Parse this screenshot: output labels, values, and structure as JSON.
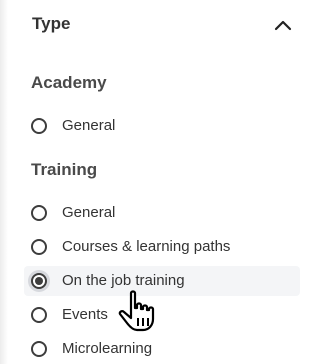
{
  "filter_group": {
    "title": "Type",
    "collapse_icon": "chevron-up-icon"
  },
  "sections": [
    {
      "title": "Academy",
      "options": [
        {
          "label": "General",
          "selected": false
        }
      ]
    },
    {
      "title": "Training",
      "options": [
        {
          "label": "General",
          "selected": false
        },
        {
          "label": "Courses & learning paths",
          "selected": false
        },
        {
          "label": "On the job training",
          "selected": true
        },
        {
          "label": "Events",
          "selected": false
        },
        {
          "label": "Microlearning",
          "selected": false
        }
      ]
    }
  ],
  "colors": {
    "text": "#333333",
    "radio": "#3d3d3d",
    "hover_background": "#f4f5f7"
  },
  "cursor": "hand-pointer-icon"
}
